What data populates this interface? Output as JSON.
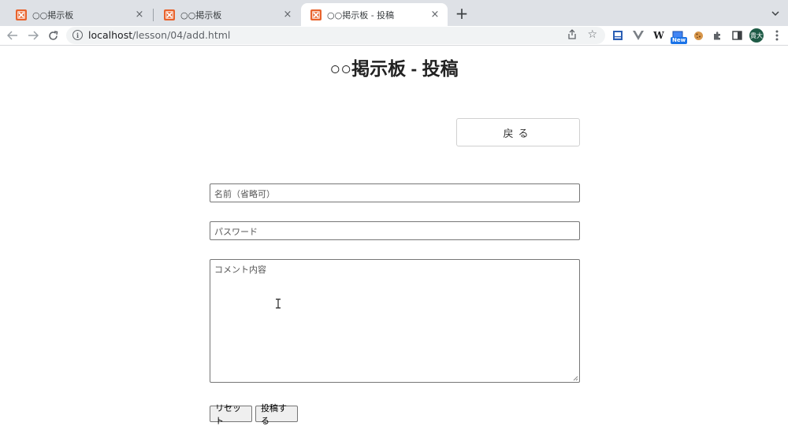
{
  "browser": {
    "tabs": [
      {
        "title": "○○掲示板",
        "active": false
      },
      {
        "title": "○○掲示板",
        "active": false
      },
      {
        "title": "○○掲示板 - 投稿",
        "active": true
      }
    ],
    "tab_close_glyph": "×",
    "new_tab_glyph": "+",
    "url_host": "localhost",
    "url_path": "/lesson/04/add.html",
    "extensions": {
      "w_label": "W",
      "new_badge": "New"
    },
    "avatar_text": "貴大"
  },
  "page": {
    "title": "○○掲示板 - 投稿",
    "back_button_label": "戻る",
    "name_placeholder": "名前（省略可）",
    "password_placeholder": "パスワード",
    "comment_placeholder": "コメント内容",
    "reset_label": "リセット",
    "submit_label": "投稿する"
  },
  "colors": {
    "favicon": "#e8622c",
    "tabstrip_bg": "#dee1e6",
    "avatar_bg": "#1e5b46"
  }
}
